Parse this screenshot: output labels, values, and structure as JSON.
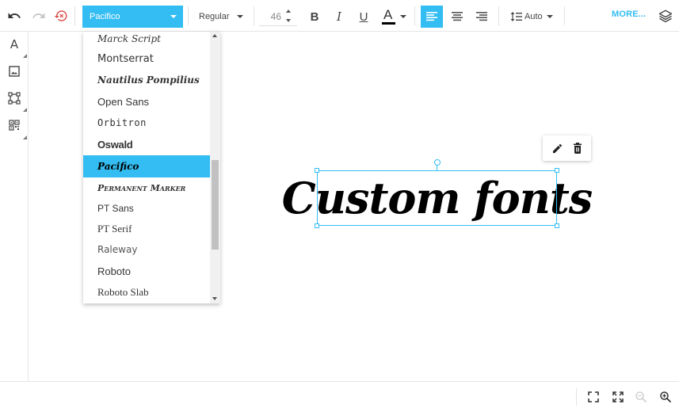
{
  "toolbar": {
    "font_family": "Pacifico",
    "font_weight": "Regular",
    "font_size": "46",
    "text_color": "#000000",
    "line_height": "Auto",
    "more_label": "MORE...",
    "accent_color": "#33bdf2",
    "icons": [
      "undo-icon",
      "redo-icon",
      "reset-icon",
      "bold-icon",
      "italic-icon",
      "underline-icon",
      "text-color-icon",
      "align-left-icon",
      "align-center-icon",
      "align-right-icon",
      "line-height-icon",
      "layers-icon"
    ],
    "active_alignment": "left"
  },
  "font_dropdown": {
    "items": [
      "Marck Script",
      "Montserrat",
      "Nautilus Pompilius",
      "Open Sans",
      "Orbitron",
      "Oswald",
      "Pacifico",
      "Permanent Marker",
      "PT Sans",
      "PT Serif",
      "Raleway",
      "Roboto",
      "Roboto Slab"
    ],
    "selected": "Pacifico"
  },
  "sidebar": {
    "tools": [
      "text-tool-icon",
      "image-tool-icon",
      "shape-tool-icon",
      "qr-code-tool-icon"
    ],
    "text_tool_letter": "A"
  },
  "canvas": {
    "text": "Custom fonts",
    "context_actions": [
      "edit-icon",
      "delete-icon"
    ]
  },
  "bottombar": {
    "icons": [
      "fit-screen-icon",
      "fullscreen-icon",
      "zoom-out-icon",
      "zoom-in-icon"
    ]
  }
}
